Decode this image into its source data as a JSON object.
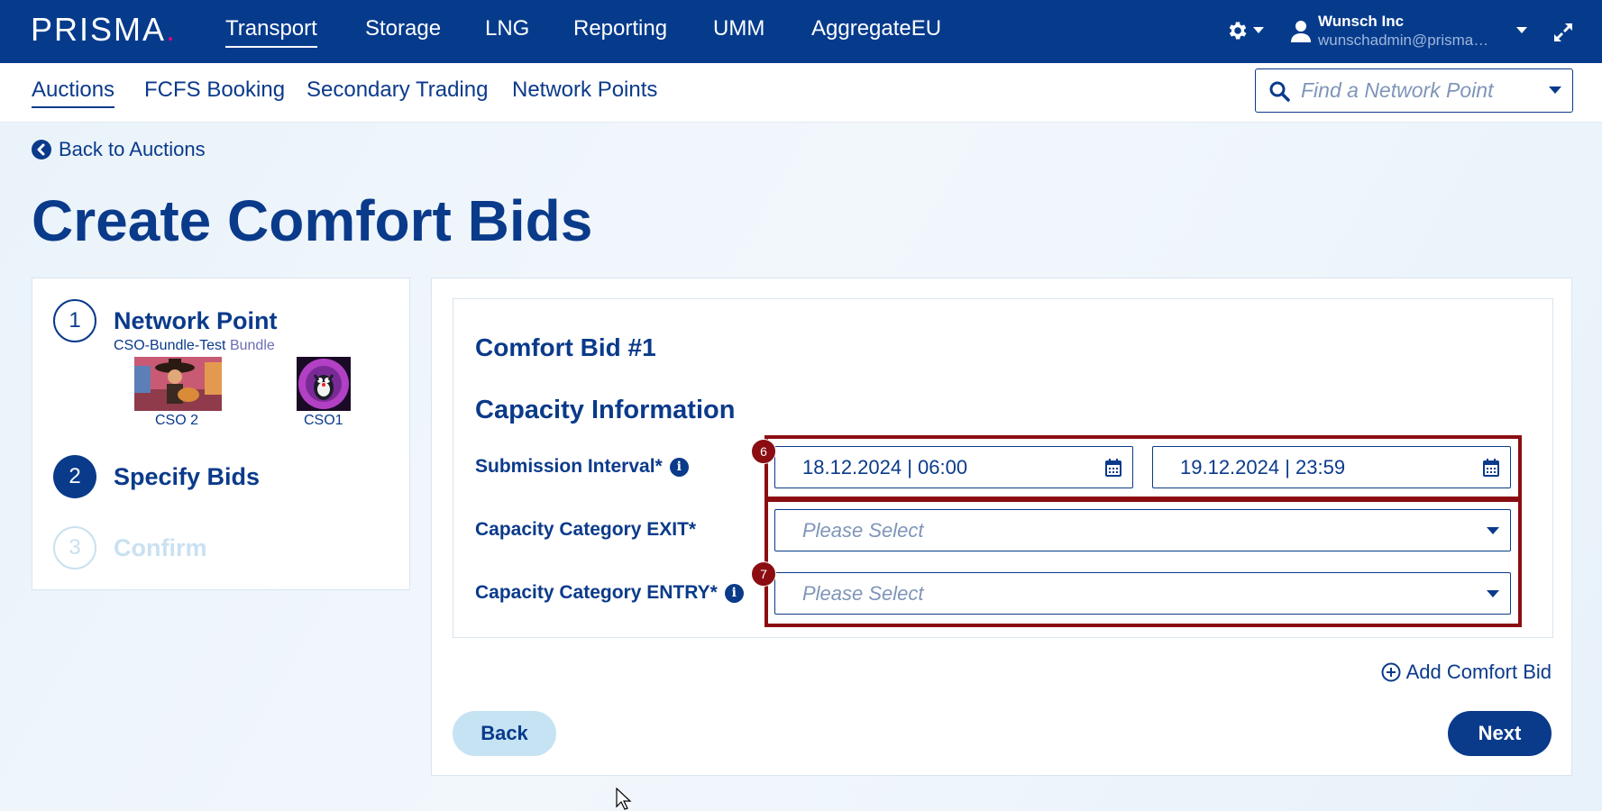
{
  "topnav": {
    "logo": "PRISMA",
    "logo_dot": ".",
    "items": [
      "Transport",
      "Storage",
      "LNG",
      "Reporting",
      "UMM",
      "AggregateEU"
    ],
    "active": "Transport",
    "user_name": "Wunsch Inc",
    "user_email": "wunschadmin@prisma-capacity.eu"
  },
  "subnav": {
    "items": [
      "Auctions",
      "FCFS Booking",
      "Secondary Trading",
      "Network Points"
    ],
    "active": "Auctions",
    "search_placeholder": "Find a Network Point"
  },
  "back_link": "Back to Auctions",
  "page_title": "Create Comfort Bids",
  "stepper": {
    "steps": [
      {
        "number": "1",
        "label": "Network Point",
        "state": "done"
      },
      {
        "number": "2",
        "label": "Specify Bids",
        "state": "active"
      },
      {
        "number": "3",
        "label": "Confirm",
        "state": "disabled"
      }
    ],
    "network_point_name": "CSO-Bundle-Test",
    "network_point_type": "Bundle",
    "cso_left": "CSO 2",
    "cso_right": "CSO1"
  },
  "bid": {
    "title": "Comfort Bid #1",
    "section_title": "Capacity Information",
    "submission_label": "Submission Interval*",
    "start_date": "18.12.2024 | 06:00",
    "end_date": "19.12.2024 | 23:59",
    "exit_label": "Capacity Category EXIT*",
    "entry_label": "Capacity Category ENTRY*",
    "exit_placeholder": "Please Select",
    "entry_placeholder": "Please Select"
  },
  "markers": {
    "first": "6",
    "second": "7"
  },
  "actions": {
    "add_bid": "Add Comfort Bid",
    "back": "Back",
    "next": "Next"
  },
  "colors": {
    "primary": "#0a3a8a",
    "nav_bg": "#063b8c",
    "highlight": "#8b0d12",
    "back_button": "#c5e3f3"
  }
}
